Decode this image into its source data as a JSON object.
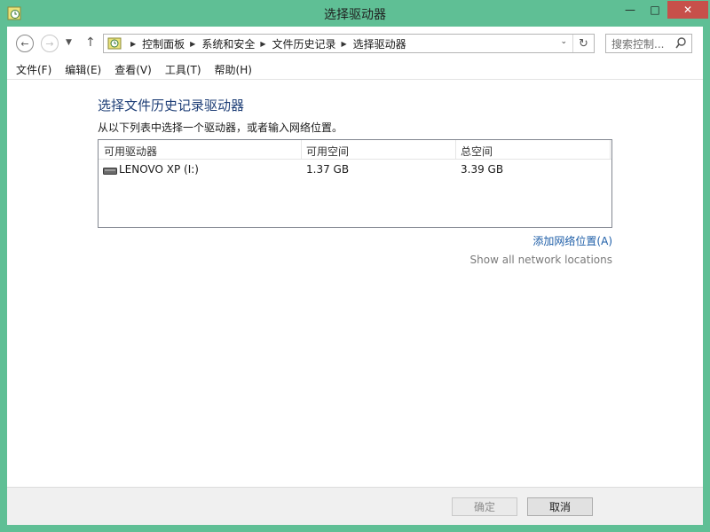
{
  "window": {
    "title": "选择驱动器",
    "controls": {
      "minimize": "—",
      "maximize": "□",
      "close": "✕"
    }
  },
  "nav": {
    "breadcrumbs": [
      "控制面板",
      "系统和安全",
      "文件历史记录",
      "选择驱动器"
    ],
    "search_placeholder": "搜索控制..."
  },
  "menu": [
    "文件(F)",
    "编辑(E)",
    "查看(V)",
    "工具(T)",
    "帮助(H)"
  ],
  "content": {
    "heading": "选择文件历史记录驱动器",
    "description": "从以下列表中选择一个驱动器，或者输入网络位置。",
    "columns": [
      "可用驱动器",
      "可用空间",
      "总空间"
    ],
    "drives": [
      {
        "name": "LENOVO XP (I:)",
        "free": "1.37 GB",
        "total": "3.39 GB"
      }
    ],
    "add_network_link": "添加网络位置(A)",
    "show_all_link": "Show all network locations"
  },
  "buttons": {
    "ok": "确定",
    "cancel": "取消"
  },
  "colors": {
    "frame": "#5fbf95",
    "close": "#c7504a",
    "link": "#1f5fa8"
  }
}
